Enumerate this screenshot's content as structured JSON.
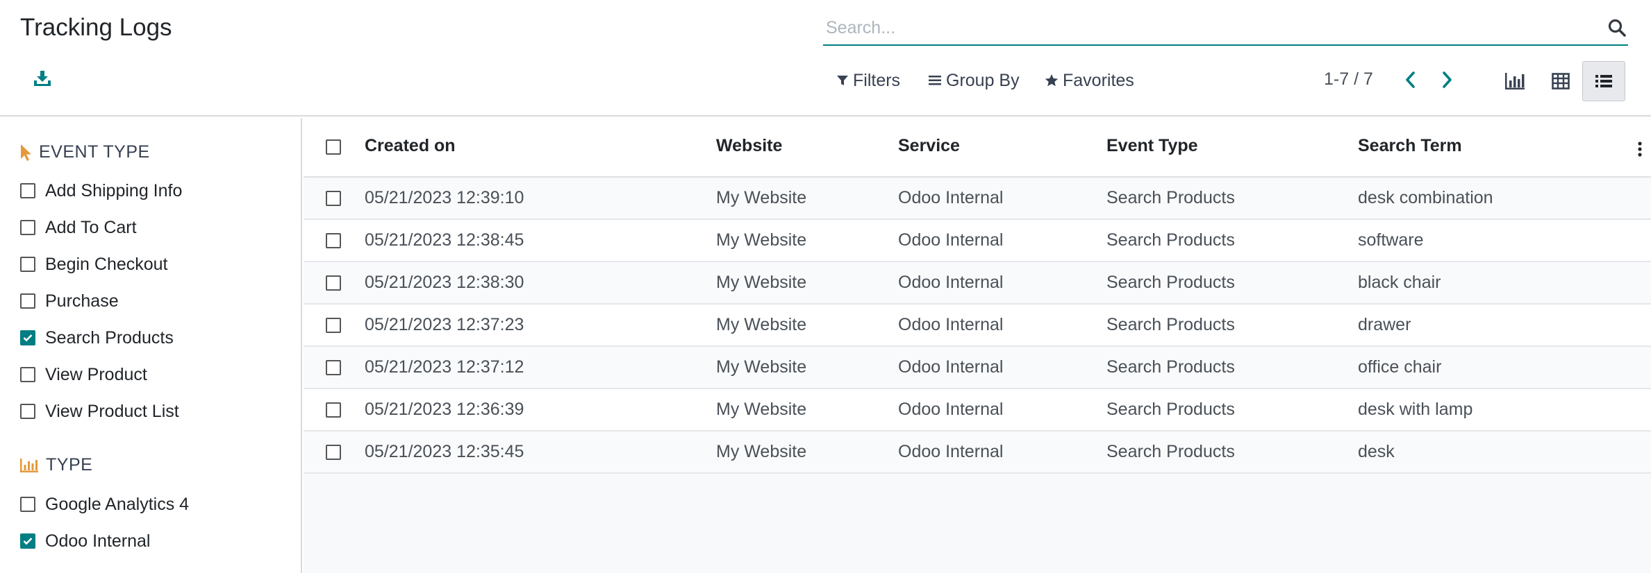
{
  "page": {
    "title": "Tracking Logs"
  },
  "search": {
    "placeholder": "Search..."
  },
  "toolbar": {
    "filters_label": "Filters",
    "group_by_label": "Group By",
    "favorites_label": "Favorites"
  },
  "pager": {
    "value": "1-7 / 7"
  },
  "sidebar": {
    "event_type": {
      "title": "EVENT TYPE",
      "items": [
        {
          "label": "Add Shipping Info",
          "checked": false
        },
        {
          "label": "Add To Cart",
          "checked": false
        },
        {
          "label": "Begin Checkout",
          "checked": false
        },
        {
          "label": "Purchase",
          "checked": false
        },
        {
          "label": "Search Products",
          "checked": true
        },
        {
          "label": "View Product",
          "checked": false
        },
        {
          "label": "View Product List",
          "checked": false
        }
      ]
    },
    "type": {
      "title": "TYPE",
      "items": [
        {
          "label": "Google Analytics 4",
          "checked": false
        },
        {
          "label": "Odoo Internal",
          "checked": true
        }
      ]
    }
  },
  "table": {
    "columns": [
      "Created on",
      "Website",
      "Service",
      "Event Type",
      "Search Term"
    ],
    "rows": [
      [
        "05/21/2023 12:39:10",
        "My Website",
        "Odoo Internal",
        "Search Products",
        "desk combination"
      ],
      [
        "05/21/2023 12:38:45",
        "My Website",
        "Odoo Internal",
        "Search Products",
        "software"
      ],
      [
        "05/21/2023 12:38:30",
        "My Website",
        "Odoo Internal",
        "Search Products",
        "black chair"
      ],
      [
        "05/21/2023 12:37:23",
        "My Website",
        "Odoo Internal",
        "Search Products",
        "drawer"
      ],
      [
        "05/21/2023 12:37:12",
        "My Website",
        "Odoo Internal",
        "Search Products",
        "office chair"
      ],
      [
        "05/21/2023 12:36:39",
        "My Website",
        "Odoo Internal",
        "Search Products",
        "desk with lamp"
      ],
      [
        "05/21/2023 12:35:45",
        "My Website",
        "Odoo Internal",
        "Search Products",
        "desk"
      ]
    ]
  },
  "colors": {
    "accent": "#017e84",
    "section_icon": "#e49a3a"
  },
  "icons": {
    "download": "download-icon",
    "search": "search-icon",
    "filter": "filter-icon",
    "group_by": "group-by-icon",
    "favorites": "star-icon",
    "pager_prev": "chevron-left-icon",
    "pager_next": "chevron-right-icon",
    "graph_view": "bar-chart-icon",
    "pivot_view": "table-icon",
    "list_view": "list-icon",
    "event_type_section": "pointer-icon",
    "type_section": "bar-chart-icon",
    "optional_columns": "vertical-dots-icon"
  }
}
